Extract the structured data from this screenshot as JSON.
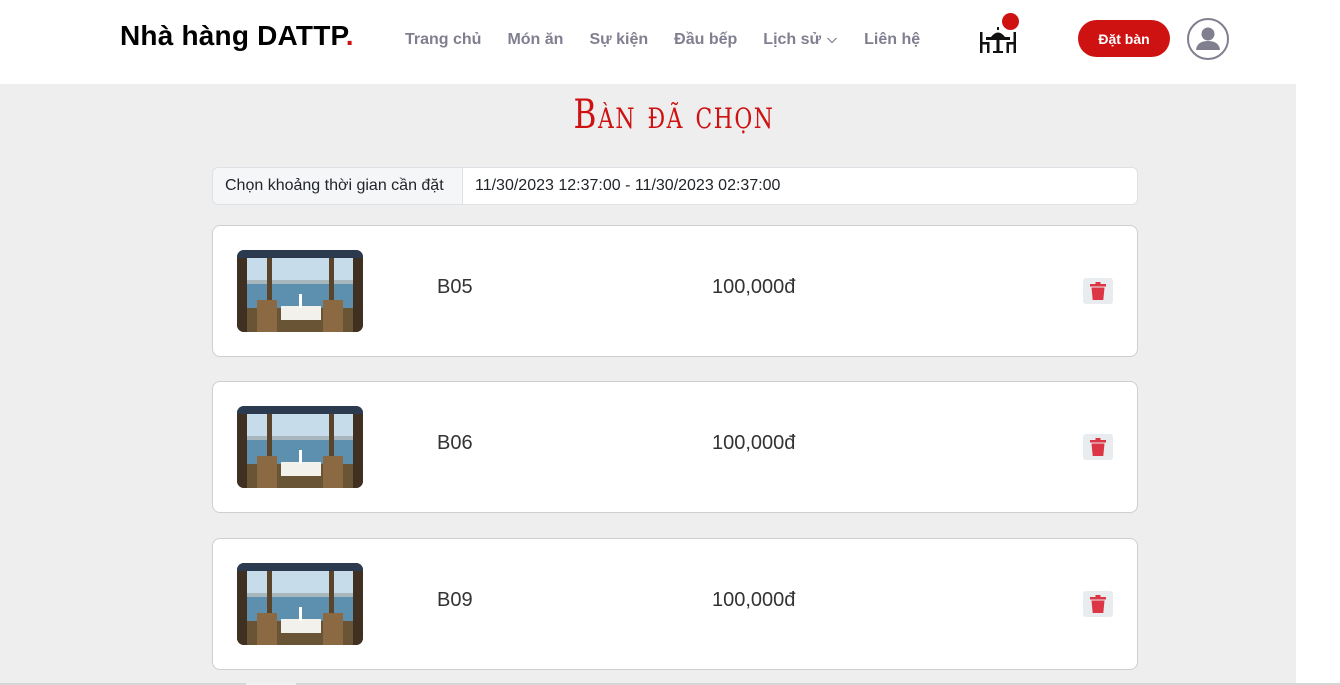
{
  "header": {
    "brand_name": "Nhà hàng DATTP",
    "brand_dot": ".",
    "nav": [
      {
        "label": "Trang chủ"
      },
      {
        "label": "Món ăn"
      },
      {
        "label": "Sự kiện"
      },
      {
        "label": "Đầu bếp"
      },
      {
        "label": "Lịch sử",
        "has_dropdown": true
      },
      {
        "label": "Liên hệ"
      }
    ],
    "cart_icon": "table-chairs-icon",
    "book_button": "Đặt bàn",
    "avatar_icon": "user-avatar-icon"
  },
  "main": {
    "title": "Bàn đã chọn",
    "time_label": "Chọn khoảng thời gian cần đặt",
    "time_value": "11/30/2023 12:37:00 - 11/30/2023 02:37:00",
    "tables": [
      {
        "name": "B05",
        "price": "100,000đ"
      },
      {
        "name": "B06",
        "price": "100,000đ"
      },
      {
        "name": "B09",
        "price": "100,000đ"
      }
    ]
  },
  "colors": {
    "accent": "#ce1212",
    "nav_text": "#7f7f90",
    "page_bg": "#eeeeee",
    "delete_icon": "#dc3545"
  }
}
